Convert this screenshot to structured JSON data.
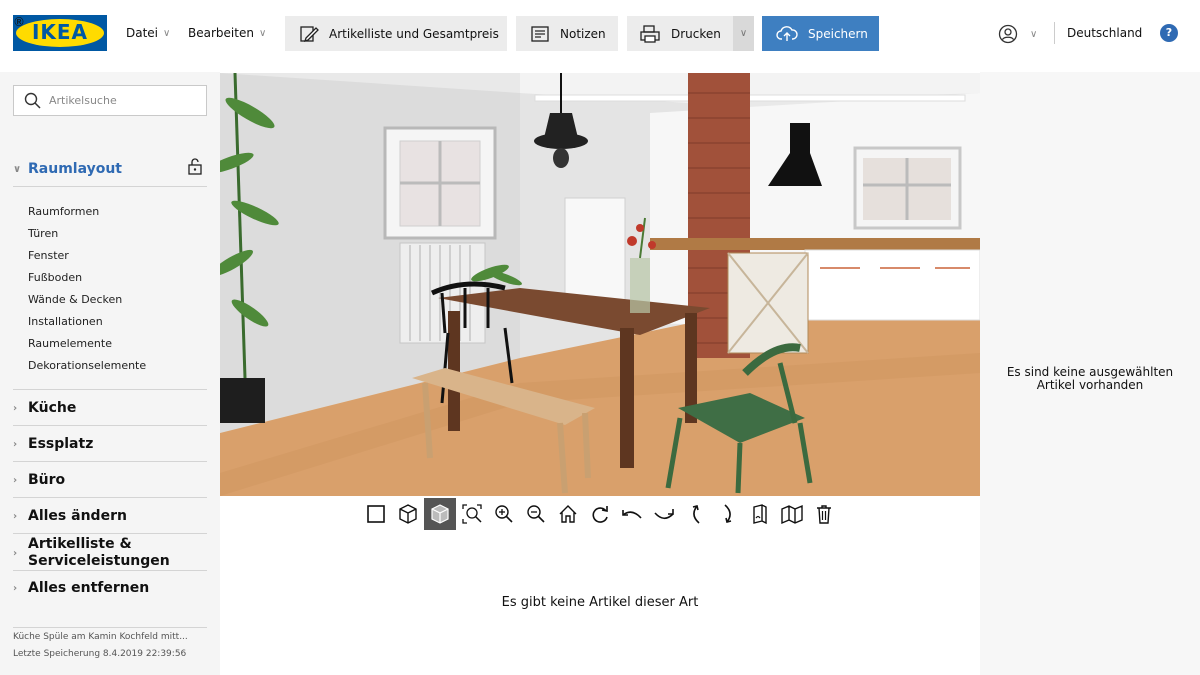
{
  "brand": {
    "logo_text": "IKEA",
    "logo_mark": "®"
  },
  "header": {
    "menu": [
      {
        "label": "Datei"
      },
      {
        "label": "Bearbeiten"
      }
    ],
    "buttons": {
      "itemlist": "Artikelliste und Gesamtpreis",
      "notes": "Notizen",
      "print": "Drucken",
      "save": "Speichern"
    },
    "country": "Deutschland",
    "help": "?"
  },
  "sidebar": {
    "search_placeholder": "Artikelsuche",
    "active_section": {
      "label": "Raumlayout",
      "items": [
        "Raumformen",
        "Türen",
        "Fenster",
        "Fußboden",
        "Wände & Decken",
        "Installationen",
        "Raumelemente",
        "Dekorationselemente"
      ]
    },
    "sections": [
      {
        "label": "Küche"
      },
      {
        "label": "Essplatz"
      },
      {
        "label": "Büro"
      },
      {
        "label": "Alles ändern"
      },
      {
        "label": "Artikelliste & Serviceleistungen"
      },
      {
        "label": "Alles entfernen"
      }
    ],
    "footer": {
      "project_name": "Küche Spüle am Kamin Kochfeld mitt...",
      "last_saved": "Letzte Speicherung 8.4.2019 22:39:56"
    }
  },
  "main": {
    "empty_message": "Es gibt keine Artikel dieser Art"
  },
  "right_panel": {
    "empty_message_line1": "Es sind keine ausgewählten",
    "empty_message_line2": "Artikel vorhanden"
  },
  "colors": {
    "accent": "#2f6ab3",
    "save_button": "#3e7fc1",
    "logo_blue": "#0058a3",
    "logo_yellow": "#ffdb00"
  },
  "toolbar_icons": [
    "2d-view-icon",
    "3d-view-icon",
    "3d-solid-view-icon",
    "zoom-fit-icon",
    "zoom-in-icon",
    "zoom-out-icon",
    "home-view-icon",
    "rotate-left-icon",
    "orbit-left-icon",
    "orbit-right-icon",
    "tilt-up-icon",
    "tilt-down-icon",
    "wall-toggle-icon",
    "walls-view-icon",
    "trash-icon"
  ]
}
